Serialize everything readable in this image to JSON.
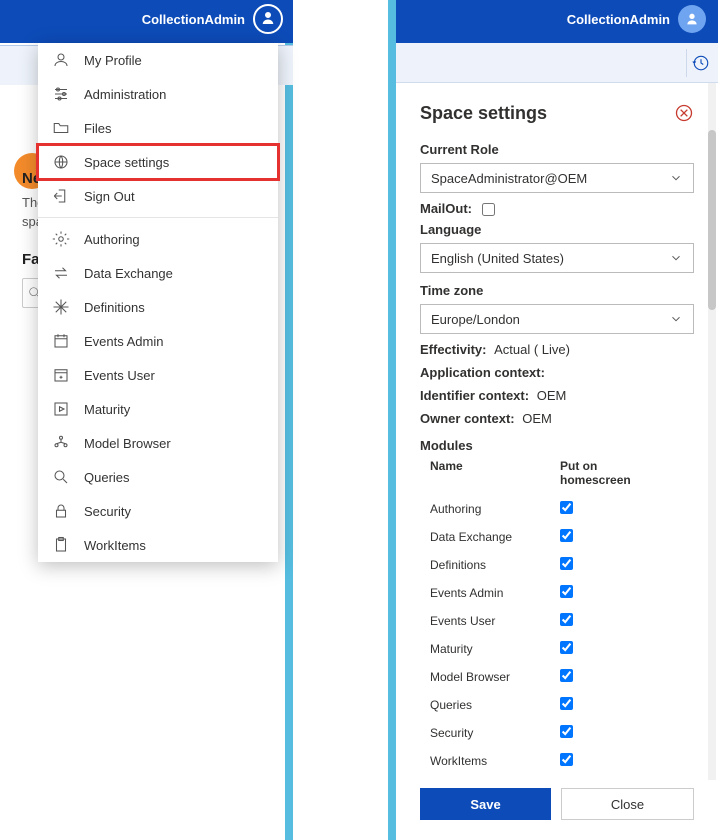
{
  "left": {
    "username": "CollectionAdmin",
    "news_heading": "News",
    "news_line1": "There",
    "news_line2": "space",
    "fav_heading": "Favo",
    "menu": {
      "profile": "My Profile",
      "administration": "Administration",
      "files": "Files",
      "space_settings": "Space settings",
      "sign_out": "Sign Out",
      "authoring": "Authoring",
      "data_exchange": "Data Exchange",
      "definitions": "Definitions",
      "events_admin": "Events Admin",
      "events_user": "Events User",
      "maturity": "Maturity",
      "model_browser": "Model Browser",
      "queries": "Queries",
      "security": "Security",
      "workitems": "WorkItems"
    }
  },
  "right": {
    "username": "CollectionAdmin",
    "title": "Space settings",
    "labels": {
      "current_role": "Current Role",
      "mailout": "MailOut:",
      "language": "Language",
      "timezone": "Time zone",
      "effectivity": "Effectivity:",
      "app_context": "Application context:",
      "id_context": "Identifier context:",
      "owner_context": "Owner context:",
      "modules": "Modules",
      "col_name": "Name",
      "col_home": "Put on homescreen"
    },
    "values": {
      "current_role": "SpaceAdministrator@OEM",
      "language": "English (United States)",
      "timezone": "Europe/London",
      "effectivity": "Actual ( Live)",
      "id_context": "OEM",
      "owner_context": "OEM"
    },
    "modules": [
      {
        "name": "Authoring",
        "on": true
      },
      {
        "name": "Data Exchange",
        "on": true
      },
      {
        "name": "Definitions",
        "on": true
      },
      {
        "name": "Events Admin",
        "on": true
      },
      {
        "name": "Events User",
        "on": true
      },
      {
        "name": "Maturity",
        "on": true
      },
      {
        "name": "Model Browser",
        "on": true
      },
      {
        "name": "Queries",
        "on": true
      },
      {
        "name": "Security",
        "on": true
      },
      {
        "name": "WorkItems",
        "on": true
      }
    ],
    "buttons": {
      "save": "Save",
      "close": "Close"
    }
  }
}
